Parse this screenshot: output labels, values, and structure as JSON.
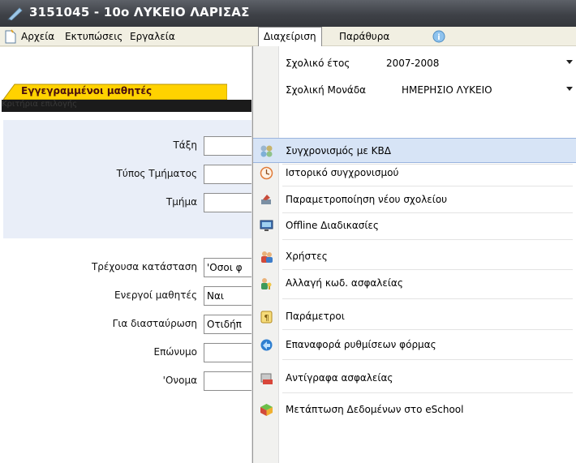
{
  "window": {
    "title": "3151045 - 10ο ΛΥΚΕΙΟ ΛΑΡΙΣΑΣ",
    "app_icon": "pen-icon"
  },
  "menubar": {
    "items": [
      "Αρχεία",
      "Εκτυπώσεις",
      "Εργαλεία",
      "Διαχείριση",
      "Παράθυρα"
    ],
    "active": "Διαχείριση",
    "help_icon": "help-icon"
  },
  "tab": {
    "label": "Εγγεγραμμένοι μαθητές"
  },
  "darkbar": {
    "ghost_text": "Κριτήρια επιλογής"
  },
  "form": {
    "fields": [
      {
        "label": "Τάξη",
        "value": ""
      },
      {
        "label": "Τύπος Τμήματος",
        "value": ""
      },
      {
        "label": "Τμήμα",
        "value": ""
      },
      {
        "label": "Τρέχουσα κατάσταση",
        "value": "'Οσοι φ"
      },
      {
        "label": "Ενεργοί μαθητές",
        "value": "Ναι"
      },
      {
        "label": "Για διασταύρωση",
        "value": "Οτιδήπ"
      },
      {
        "label": "Επώνυμο",
        "value": ""
      },
      {
        "label": "'Ονομα",
        "value": ""
      }
    ]
  },
  "dropdown": {
    "school_year": {
      "label": "Σχολικό έτος",
      "value": "2007-2008"
    },
    "school_unit": {
      "label": "Σχολική Μονάδα",
      "value": "ΗΜΕΡΗΣΙΟ ΛΥΚΕΙΟ"
    },
    "items": [
      {
        "label": "Συγχρονισμός με ΚΒΔ",
        "icon": "sync-icon",
        "highlighted": true
      },
      {
        "label": "Ιστορικό συγχρονισμού",
        "icon": "clock-icon"
      },
      {
        "label": "Παραμετροποίηση νέου σχολείου",
        "icon": "tools-icon"
      },
      {
        "label": "Offline Διαδικασίες",
        "icon": "monitor-icon"
      },
      {
        "label": "Χρήστες",
        "icon": "users-icon"
      },
      {
        "label": "Αλλαγή κωδ. ασφαλείας",
        "icon": "user-key-icon"
      },
      {
        "label": "Παράμετροι",
        "icon": "parameters-icon"
      },
      {
        "label": "Επαναφορά ρυθμίσεων φόρμας",
        "icon": "restore-icon"
      },
      {
        "label": "Αντίγραφα ασφαλείας",
        "icon": "backup-icon"
      },
      {
        "label": "Μετάπτωση Δεδομένων στο eSchool",
        "icon": "cube-icon"
      }
    ]
  },
  "colors": {
    "titlebar": "#3e4147",
    "highlight": "#d7e4f6",
    "tab": "#ffd200",
    "panel": "#e9eef8"
  }
}
